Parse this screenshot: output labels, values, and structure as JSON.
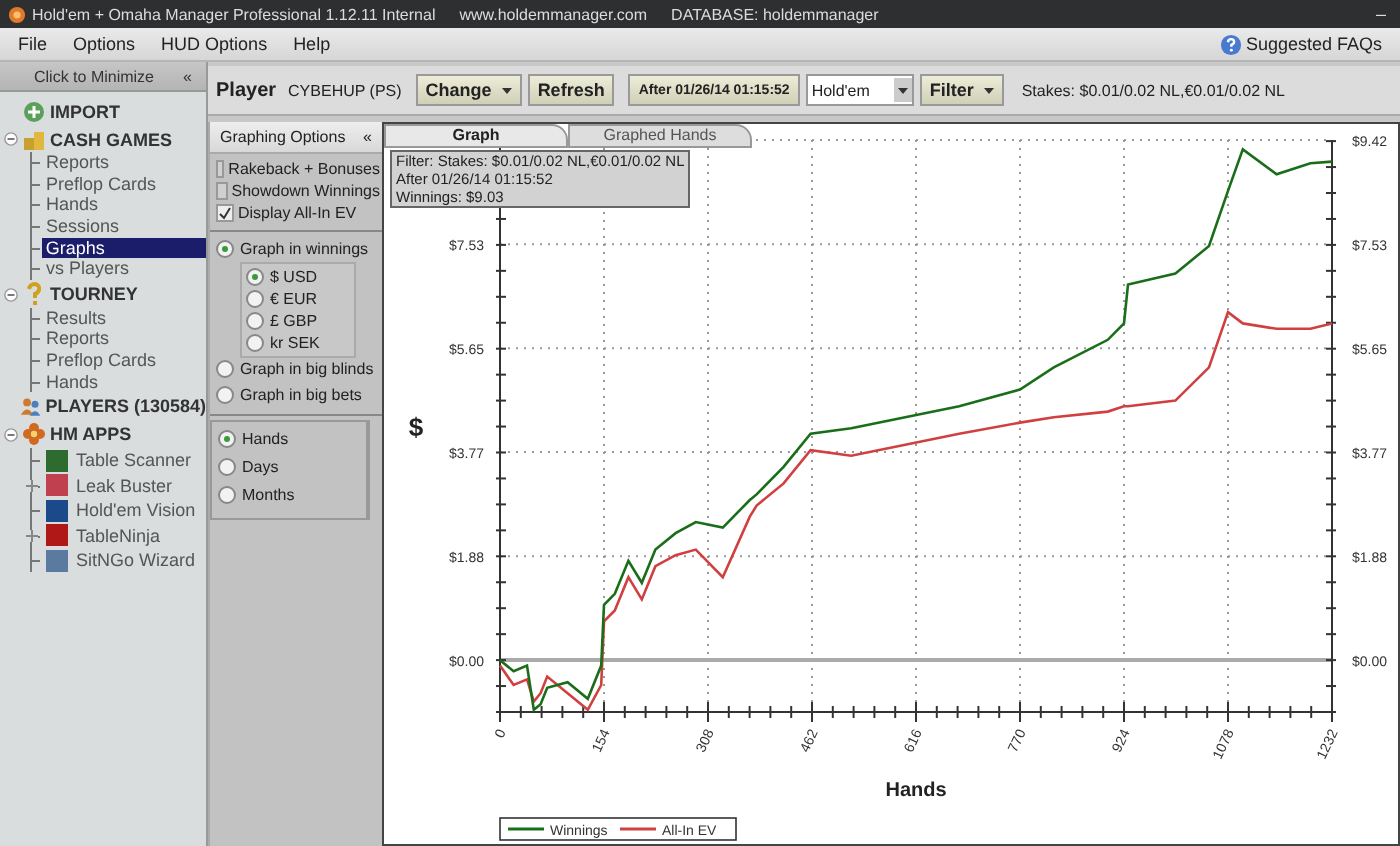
{
  "window": {
    "title": "Hold'em + Omaha Manager Professional 1.12.11 Internal",
    "url": "www.holdemmanager.com",
    "database": "DATABASE: holdemmanager",
    "minimize_glyph": "–"
  },
  "menu": {
    "items": [
      "File",
      "Options",
      "HUD Options",
      "Help"
    ],
    "help_link": "Suggested FAQs"
  },
  "sidebar": {
    "minimize_label": "Click to Minimize",
    "minimize_glyph": "«",
    "sections": [
      {
        "label": "IMPORT",
        "kind": "import"
      },
      {
        "label": "CASH GAMES",
        "kind": "cash",
        "expanded": true,
        "children": [
          {
            "label": "Reports",
            "selected": false
          },
          {
            "label": "Preflop Cards",
            "selected": false
          },
          {
            "label": "Hands",
            "selected": false
          },
          {
            "label": "Sessions",
            "selected": false
          },
          {
            "label": "Graphs",
            "selected": true
          },
          {
            "label": "vs Players",
            "selected": false
          }
        ]
      },
      {
        "label": "TOURNEY",
        "kind": "tourney",
        "expanded": true,
        "children": [
          {
            "label": "Results",
            "selected": false
          },
          {
            "label": "Reports",
            "selected": false
          },
          {
            "label": "Preflop Cards",
            "selected": false
          },
          {
            "label": "Hands",
            "selected": false
          }
        ]
      },
      {
        "label": "PLAYERS (130584)",
        "kind": "players"
      },
      {
        "label": "HM APPS",
        "kind": "apps",
        "expanded": true
      }
    ],
    "apps": [
      {
        "label": "Table Scanner",
        "color": "#2e6b2e",
        "expandable": false
      },
      {
        "label": "Leak Buster",
        "color": "#c04050",
        "expandable": true
      },
      {
        "label": "Hold'em Vision",
        "color": "#1a4a8a",
        "expandable": false
      },
      {
        "label": "TableNinja",
        "color": "#b01818",
        "expandable": true
      },
      {
        "label": "SitNGo Wizard",
        "color": "#5a7aa0",
        "expandable": false
      }
    ]
  },
  "toolbar": {
    "player_label": "Player",
    "player": "CYBEHUP (PS)",
    "change_button": "Change",
    "refresh_button": "Refresh",
    "date_button": "After 01/26/14 01:15:52",
    "game_select": "Hold'em",
    "filter_button": "Filter",
    "stakes": "Stakes: $0.01/0.02 NL,€0.01/0.02 NL"
  },
  "options": {
    "title": "Graphing Options",
    "collapse_glyph": "«",
    "checkboxes": [
      {
        "label": "Rakeback + Bonuses",
        "checked": false
      },
      {
        "label": "Showdown Winnings",
        "checked": false
      },
      {
        "label": "Display All-In EV",
        "checked": true
      }
    ],
    "modes": [
      {
        "label": "Graph in winnings",
        "selected": true
      },
      {
        "label": "Graph in big blinds",
        "selected": false
      },
      {
        "label": "Graph in big bets",
        "selected": false
      }
    ],
    "currencies": [
      {
        "label": "$ USD",
        "selected": true
      },
      {
        "label": "€ EUR",
        "selected": false
      },
      {
        "label": "£ GBP",
        "selected": false
      },
      {
        "label": "kr SEK",
        "selected": false
      }
    ],
    "periods": [
      {
        "label": "Hands",
        "selected": true
      },
      {
        "label": "Days",
        "selected": false
      },
      {
        "label": "Months",
        "selected": false
      }
    ]
  },
  "tabs": [
    {
      "label": "Graph",
      "selected": true
    },
    {
      "label": "Graphed Hands",
      "selected": false
    }
  ],
  "filter_box": [
    "Filter: Stakes: $0.01/0.02 NL,€0.01/0.02 NL",
    "After 01/26/14 01:15:52",
    "Winnings: $9.03"
  ],
  "graph": {
    "chart_data": {
      "type": "line",
      "grid": true,
      "legend": true,
      "xlabel": "Hands",
      "ylabel": "$",
      "xlim": [
        0,
        1232
      ],
      "ylim": [
        -0.94,
        9.42
      ],
      "xticks": [
        0,
        154,
        308,
        462,
        616,
        770,
        924,
        1078,
        1232
      ],
      "yticks": [
        {
          "value": 0,
          "label": "$0.00"
        },
        {
          "value": 1.88,
          "label": "$1.88"
        },
        {
          "value": 3.77,
          "label": "$3.77"
        },
        {
          "value": 5.65,
          "label": "$5.65"
        },
        {
          "value": 7.53,
          "label": "$7.53"
        },
        {
          "value": 9.42,
          "label": "$9.42"
        }
      ],
      "x": [
        0,
        20,
        40,
        50,
        60,
        70,
        100,
        130,
        150,
        154,
        170,
        190,
        210,
        230,
        260,
        290,
        330,
        370,
        380,
        420,
        460,
        520,
        600,
        680,
        770,
        820,
        900,
        924,
        930,
        1000,
        1050,
        1078,
        1100,
        1150,
        1200,
        1232
      ],
      "series": [
        {
          "name": "Winnings",
          "color": "#1a6e1a",
          "values": [
            0,
            -0.2,
            -0.1,
            -0.9,
            -0.8,
            -0.5,
            -0.4,
            -0.7,
            -0.1,
            1.0,
            1.2,
            1.8,
            1.4,
            2.0,
            2.3,
            2.5,
            2.4,
            2.9,
            3.0,
            3.5,
            4.1,
            4.2,
            4.4,
            4.6,
            4.9,
            5.3,
            5.8,
            6.1,
            6.8,
            7.0,
            7.5,
            8.5,
            9.25,
            8.8,
            9.0,
            9.03
          ]
        },
        {
          "name": "All-In EV",
          "color": "#d04040",
          "values": [
            -0.1,
            -0.45,
            -0.35,
            -0.75,
            -0.6,
            -0.3,
            -0.6,
            -0.9,
            -0.45,
            0.7,
            0.9,
            1.5,
            1.1,
            1.7,
            1.9,
            2.0,
            1.5,
            2.6,
            2.8,
            3.2,
            3.8,
            3.7,
            3.9,
            4.1,
            4.3,
            4.4,
            4.5,
            4.6,
            4.6,
            4.7,
            5.3,
            6.3,
            6.1,
            6.0,
            6.0,
            6.1
          ]
        }
      ]
    }
  }
}
